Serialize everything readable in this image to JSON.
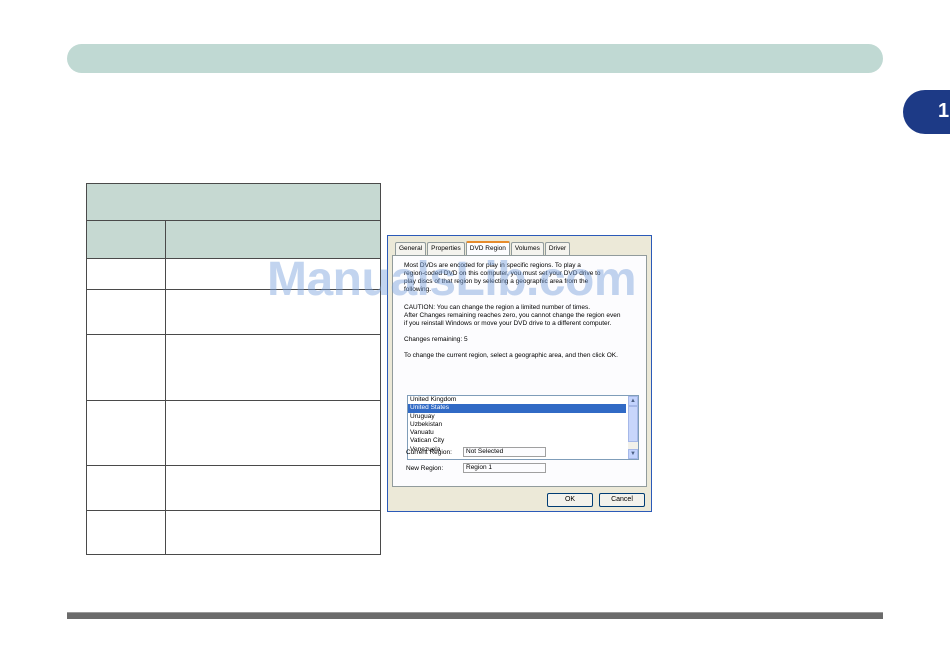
{
  "chapter": {
    "number": "1"
  },
  "table": {
    "title": "",
    "headers": [
      "",
      ""
    ],
    "rows": [
      [
        "",
        ""
      ],
      [
        "",
        ""
      ],
      [
        "",
        ""
      ],
      [
        "",
        ""
      ],
      [
        "",
        ""
      ],
      [
        "",
        ""
      ]
    ]
  },
  "dialog": {
    "tabs": [
      "General",
      "Properties",
      "DVD Region",
      "Volumes",
      "Driver"
    ],
    "intro_lines": [
      "Most DVDs are encoded for play in specific regions. To play a",
      "region-coded DVD on this computer, you must set your DVD drive to",
      "play discs of that region by selecting a geographic area from the",
      "following."
    ],
    "caution_lines": [
      "CAUTION:  You can change the region a limited number of times.",
      "After Changes remaining reaches zero, you cannot change the region even",
      "if you reinstall Windows or move your DVD drive to a different computer."
    ],
    "changes_remaining": "Changes remaining: 5",
    "instruction": "To change the current region, select a geographic area, and then click OK.",
    "regions": [
      "United Kingdom",
      "United States",
      "Uruguay",
      "Uzbekistan",
      "Vanuatu",
      "Vatican City",
      "Venezuela"
    ],
    "selected_region": "United States",
    "current_region_label": "Current Region:",
    "current_region_value": "Not Selected",
    "new_region_label": "New Region:",
    "new_region_value": "Region 1",
    "ok_label": "OK",
    "cancel_label": "Cancel"
  },
  "watermark": "ManualsLib.com"
}
